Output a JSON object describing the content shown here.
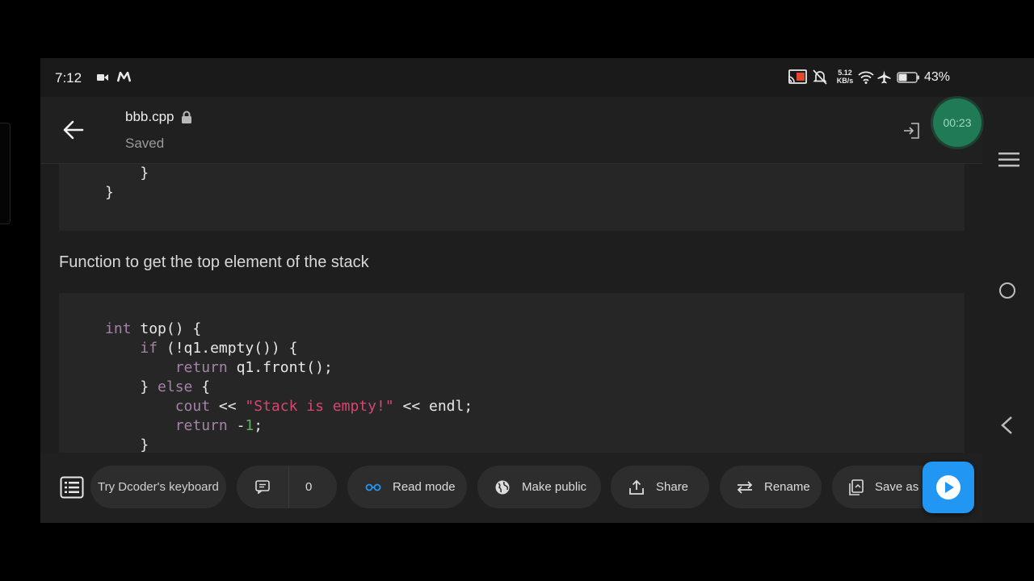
{
  "status_bar": {
    "time": "7:12",
    "network_speed_value": "5.12",
    "network_speed_unit": "KB/s",
    "battery_percent": "43%"
  },
  "app_bar": {
    "file_name": "bbb.cpp",
    "save_status": "Saved",
    "timer": "00:23"
  },
  "content": {
    "code_block_1_lines": [
      "    }",
      "}"
    ],
    "paragraph": "Function to get the top element of the stack",
    "code_block_2": {
      "l1_kw": "int",
      "l1_rest": " top() {",
      "l2_indent": "    ",
      "l2_kw": "if",
      "l2_rest": " (!q1.empty()) {",
      "l3_indent": "        ",
      "l3_kw": "return",
      "l3_rest": " q1.front();",
      "l4_a": "    } ",
      "l4_kw": "else",
      "l4_rest": " {",
      "l5_indent": "        ",
      "l5_kw": "cout",
      "l5_mid": " << ",
      "l5_str": "\"Stack is empty!\"",
      "l5_rest": " << endl;",
      "l6_indent": "        ",
      "l6_kw": "return",
      "l6_mid": " -",
      "l6_num": "1",
      "l6_rest": ";",
      "l7": "    }"
    }
  },
  "toolbar": {
    "keyboard_hint": "Try Dcoder's keyboard",
    "comments_count": "0",
    "read_mode": "Read mode",
    "make_public": "Make public",
    "share": "Share",
    "rename": "Rename",
    "save_as": "Save as"
  },
  "colors": {
    "accent_blue": "#2196f3",
    "timer_green": "#1f7a55",
    "keyword": "#a583a8",
    "string": "#d6476f",
    "number": "#5ab55f"
  }
}
